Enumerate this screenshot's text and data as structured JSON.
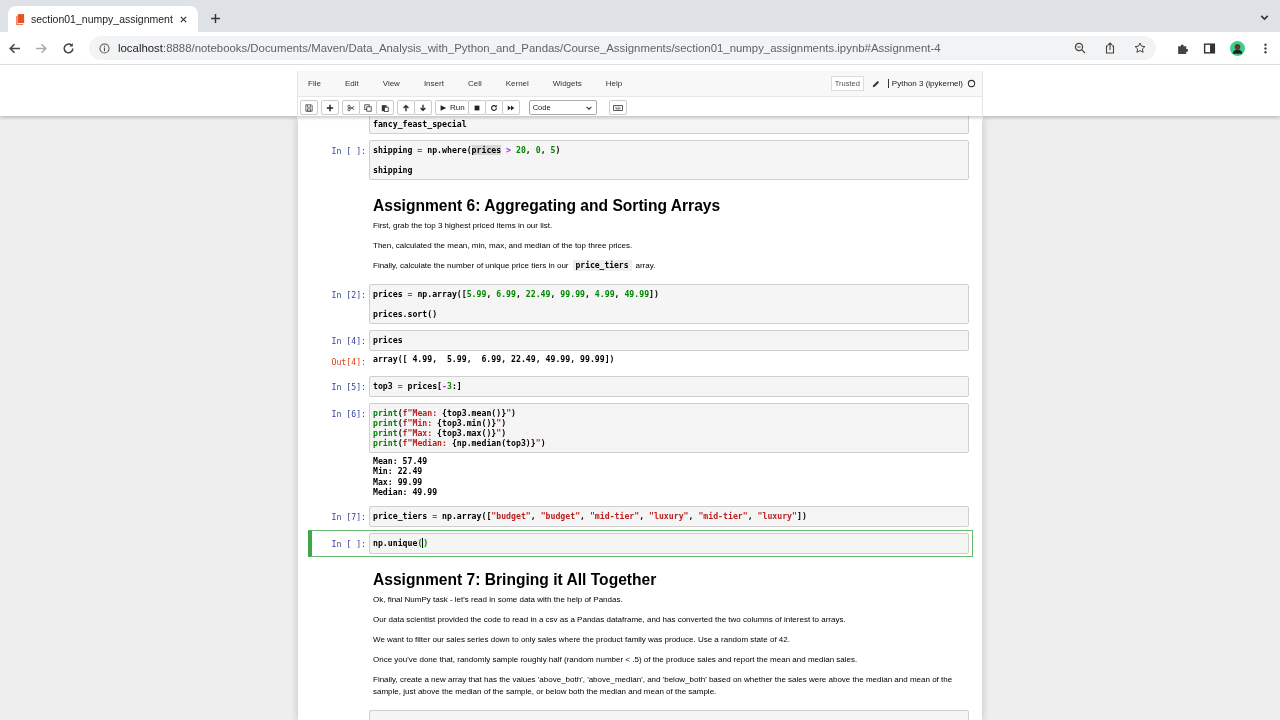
{
  "browser": {
    "tab": {
      "title": "section01_numpy_assignment"
    },
    "url": {
      "host": "localhost",
      "path": ":8888/notebooks/Documents/Maven/Data_Analysis_with_Python_and_Pandas/Course_Assignments/section01_numpy_assignments.ipynb#Assignment-4"
    }
  },
  "jupyter": {
    "menu": [
      "File",
      "Edit",
      "View",
      "Insert",
      "Cell",
      "Kernel",
      "Widgets",
      "Help"
    ],
    "trusted": "Trusted",
    "kernel": "Python 3 (ipykernel)",
    "run": "Run",
    "cell_type": "Code"
  },
  "cells": [
    {
      "kind": "code",
      "selected": false,
      "blocks": [
        {
          "lines": [
            [
              {
                "text": "fancy_feast_special",
                "kind": "plain"
              }
            ]
          ]
        }
      ]
    },
    {
      "kind": "code",
      "prompt": "In [ ]:",
      "selected": false,
      "blocks": [
        {
          "lines": [
            [
              {
                "text": "shipping",
                "kind": "plain"
              },
              {
                "text": " = ",
                "kind": "op"
              },
              {
                "text": "np.where(",
                "kind": "plain"
              },
              {
                "text": "prices",
                "kind": "hl"
              },
              {
                "text": " > ",
                "kind": "op"
              },
              {
                "text": "20",
                "kind": "num"
              },
              {
                "text": ", ",
                "kind": "plain"
              },
              {
                "text": "0",
                "kind": "num"
              },
              {
                "text": ", ",
                "kind": "plain"
              },
              {
                "text": "5",
                "kind": "num"
              },
              {
                "text": ")",
                "kind": "plain"
              }
            ]
          ]
        },
        {
          "lines": [
            [
              {
                "text": "shipping",
                "kind": "plain"
              }
            ]
          ]
        }
      ]
    },
    {
      "kind": "markdown",
      "heading": "Assignment 6: Aggregating and Sorting Arrays",
      "paragraphs": [
        [
          {
            "text": "First, grab the top 3 highest priced items in our list.",
            "kind": "text"
          }
        ],
        [
          {
            "text": "Then, calculated the mean, min, max, and median of the top three prices.",
            "kind": "text"
          }
        ],
        [
          {
            "text": "Finally, calculate the number of unique price tiers in our",
            "kind": "text"
          },
          {
            "text": "price_tiers",
            "kind": "code"
          },
          {
            "text": "array.",
            "kind": "text"
          }
        ]
      ]
    },
    {
      "kind": "code",
      "prompt": "In [2]:",
      "selected": false,
      "blocks": [
        {
          "lines": [
            [
              {
                "text": "prices",
                "kind": "plain"
              },
              {
                "text": " = ",
                "kind": "op"
              },
              {
                "text": "np.array([",
                "kind": "plain"
              },
              {
                "text": "5.99",
                "kind": "num"
              },
              {
                "text": ", ",
                "kind": "plain"
              },
              {
                "text": "6.99",
                "kind": "num"
              },
              {
                "text": ", ",
                "kind": "plain"
              },
              {
                "text": "22.49",
                "kind": "num"
              },
              {
                "text": ", ",
                "kind": "plain"
              },
              {
                "text": "99.99",
                "kind": "num"
              },
              {
                "text": ", ",
                "kind": "plain"
              },
              {
                "text": "4.99",
                "kind": "num"
              },
              {
                "text": ", ",
                "kind": "plain"
              },
              {
                "text": "49.99",
                "kind": "num"
              },
              {
                "text": "])",
                "kind": "plain"
              }
            ]
          ]
        },
        {
          "lines": [
            [
              {
                "text": "prices.sort()",
                "kind": "plain"
              }
            ]
          ]
        }
      ]
    },
    {
      "kind": "code",
      "prompt": "In [4]:",
      "selected": false,
      "blocks": [
        {
          "lines": [
            [
              {
                "text": "prices",
                "kind": "plain"
              }
            ]
          ]
        }
      ],
      "output": {
        "prompt": "Out[4]:",
        "text": "array([ 4.99,  5.99,  6.99, 22.49, 49.99, 99.99])"
      }
    },
    {
      "kind": "code",
      "prompt": "In [5]:",
      "selected": false,
      "blocks": [
        {
          "lines": [
            [
              {
                "text": "top3",
                "kind": "plain"
              },
              {
                "text": " = ",
                "kind": "op"
              },
              {
                "text": "prices[",
                "kind": "plain"
              },
              {
                "text": "-",
                "kind": "op"
              },
              {
                "text": "3",
                "kind": "num"
              },
              {
                "text": ":]",
                "kind": "plain"
              }
            ]
          ]
        }
      ]
    },
    {
      "kind": "code",
      "prompt": "In [6]:",
      "selected": false,
      "blocks": [
        {
          "lines": [
            [
              {
                "text": "print",
                "kind": "builtin"
              },
              {
                "text": "(",
                "kind": "plain"
              },
              {
                "text": "f\"Mean: ",
                "kind": "str"
              },
              {
                "text": "{top3.mean()}",
                "kind": "plain"
              },
              {
                "text": "\"",
                "kind": "str"
              },
              {
                "text": ")",
                "kind": "plain"
              }
            ],
            [
              {
                "text": "print",
                "kind": "builtin"
              },
              {
                "text": "(",
                "kind": "plain"
              },
              {
                "text": "f\"Min: ",
                "kind": "str"
              },
              {
                "text": "{top3.min()}",
                "kind": "plain"
              },
              {
                "text": "\"",
                "kind": "str"
              },
              {
                "text": ")",
                "kind": "plain"
              }
            ],
            [
              {
                "text": "print",
                "kind": "builtin"
              },
              {
                "text": "(",
                "kind": "plain"
              },
              {
                "text": "f\"Max: ",
                "kind": "str"
              },
              {
                "text": "{top3.max()}",
                "kind": "plain"
              },
              {
                "text": "\"",
                "kind": "str"
              },
              {
                "text": ")",
                "kind": "plain"
              }
            ],
            [
              {
                "text": "print",
                "kind": "builtin"
              },
              {
                "text": "(",
                "kind": "plain"
              },
              {
                "text": "f\"Median: ",
                "kind": "str"
              },
              {
                "text": "{np.median(top3)}",
                "kind": "plain"
              },
              {
                "text": "\"",
                "kind": "str"
              },
              {
                "text": ")",
                "kind": "plain"
              }
            ]
          ]
        }
      ],
      "output": {
        "text": "Mean: 57.49\nMin: 22.49\nMax: 99.99\nMedian: 49.99"
      }
    },
    {
      "kind": "code",
      "prompt": "In [7]:",
      "selected": false,
      "blocks": [
        {
          "lines": [
            [
              {
                "text": "price_tiers",
                "kind": "plain"
              },
              {
                "text": " = ",
                "kind": "op"
              },
              {
                "text": "np.array([",
                "kind": "plain"
              },
              {
                "text": "\"budget\"",
                "kind": "str"
              },
              {
                "text": ", ",
                "kind": "plain"
              },
              {
                "text": "\"budget\"",
                "kind": "str"
              },
              {
                "text": ", ",
                "kind": "plain"
              },
              {
                "text": "\"mid-tier\"",
                "kind": "str"
              },
              {
                "text": ", ",
                "kind": "plain"
              },
              {
                "text": "\"luxury\"",
                "kind": "str"
              },
              {
                "text": ", ",
                "kind": "plain"
              },
              {
                "text": "\"mid-tier\"",
                "kind": "str"
              },
              {
                "text": ", ",
                "kind": "plain"
              },
              {
                "text": "\"luxury\"",
                "kind": "str"
              },
              {
                "text": "])",
                "kind": "plain"
              }
            ]
          ]
        }
      ]
    },
    {
      "kind": "code",
      "prompt": "In [ ]:",
      "selected": true,
      "blocks": [
        {
          "lines": [
            [
              {
                "text": "np.unique",
                "kind": "plain"
              },
              {
                "text": "(",
                "kind": "match"
              },
              {
                "kind": "cursor"
              },
              {
                "text": ")",
                "kind": "match"
              }
            ]
          ]
        }
      ]
    },
    {
      "kind": "markdown",
      "heading": "Assignment 7: Bringing it All Together",
      "paragraphs": [
        [
          {
            "text": "Ok, final NumPy task - let's read in some data with the help of Pandas.",
            "kind": "text"
          }
        ],
        [
          {
            "text": "Our data scientist provided the code to read in a csv as a Pandas dataframe, and has converted the two columns of interest to arrays.",
            "kind": "text"
          }
        ],
        [
          {
            "text": "We want to filter our sales series down to only sales where the product family was produce. Use a random state of 42.",
            "kind": "text"
          }
        ],
        [
          {
            "text": "Once you've done that, randomly sample roughly half (random number < .5) of the produce sales and report the mean and median sales.",
            "kind": "text"
          }
        ],
        [
          {
            "text": "Finally, create a new array that has the values 'above_both', 'above_median', and 'below_both' based on whether the sales were above the median and mean of the sample, just above the median of the sample, or below both the median and mean of the sample.",
            "kind": "text"
          }
        ]
      ]
    },
    {
      "kind": "code",
      "selected": false
    }
  ]
}
